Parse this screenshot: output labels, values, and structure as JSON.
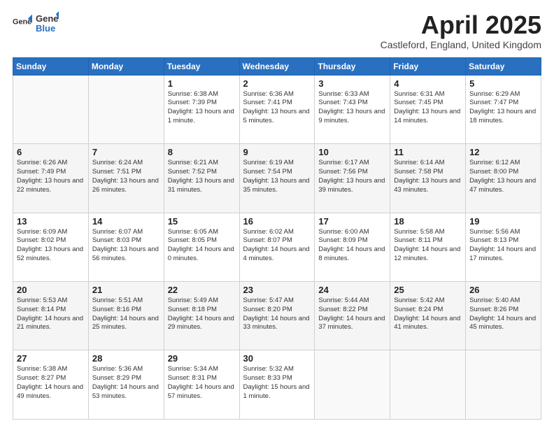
{
  "header": {
    "logo_general": "General",
    "logo_blue": "Blue",
    "month_title": "April 2025",
    "location": "Castleford, England, United Kingdom"
  },
  "days_of_week": [
    "Sunday",
    "Monday",
    "Tuesday",
    "Wednesday",
    "Thursday",
    "Friday",
    "Saturday"
  ],
  "weeks": [
    [
      {
        "day": "",
        "info": ""
      },
      {
        "day": "",
        "info": ""
      },
      {
        "day": "1",
        "info": "Sunrise: 6:38 AM\nSunset: 7:39 PM\nDaylight: 13 hours and 1 minute."
      },
      {
        "day": "2",
        "info": "Sunrise: 6:36 AM\nSunset: 7:41 PM\nDaylight: 13 hours and 5 minutes."
      },
      {
        "day": "3",
        "info": "Sunrise: 6:33 AM\nSunset: 7:43 PM\nDaylight: 13 hours and 9 minutes."
      },
      {
        "day": "4",
        "info": "Sunrise: 6:31 AM\nSunset: 7:45 PM\nDaylight: 13 hours and 14 minutes."
      },
      {
        "day": "5",
        "info": "Sunrise: 6:29 AM\nSunset: 7:47 PM\nDaylight: 13 hours and 18 minutes."
      }
    ],
    [
      {
        "day": "6",
        "info": "Sunrise: 6:26 AM\nSunset: 7:49 PM\nDaylight: 13 hours and 22 minutes."
      },
      {
        "day": "7",
        "info": "Sunrise: 6:24 AM\nSunset: 7:51 PM\nDaylight: 13 hours and 26 minutes."
      },
      {
        "day": "8",
        "info": "Sunrise: 6:21 AM\nSunset: 7:52 PM\nDaylight: 13 hours and 31 minutes."
      },
      {
        "day": "9",
        "info": "Sunrise: 6:19 AM\nSunset: 7:54 PM\nDaylight: 13 hours and 35 minutes."
      },
      {
        "day": "10",
        "info": "Sunrise: 6:17 AM\nSunset: 7:56 PM\nDaylight: 13 hours and 39 minutes."
      },
      {
        "day": "11",
        "info": "Sunrise: 6:14 AM\nSunset: 7:58 PM\nDaylight: 13 hours and 43 minutes."
      },
      {
        "day": "12",
        "info": "Sunrise: 6:12 AM\nSunset: 8:00 PM\nDaylight: 13 hours and 47 minutes."
      }
    ],
    [
      {
        "day": "13",
        "info": "Sunrise: 6:09 AM\nSunset: 8:02 PM\nDaylight: 13 hours and 52 minutes."
      },
      {
        "day": "14",
        "info": "Sunrise: 6:07 AM\nSunset: 8:03 PM\nDaylight: 13 hours and 56 minutes."
      },
      {
        "day": "15",
        "info": "Sunrise: 6:05 AM\nSunset: 8:05 PM\nDaylight: 14 hours and 0 minutes."
      },
      {
        "day": "16",
        "info": "Sunrise: 6:02 AM\nSunset: 8:07 PM\nDaylight: 14 hours and 4 minutes."
      },
      {
        "day": "17",
        "info": "Sunrise: 6:00 AM\nSunset: 8:09 PM\nDaylight: 14 hours and 8 minutes."
      },
      {
        "day": "18",
        "info": "Sunrise: 5:58 AM\nSunset: 8:11 PM\nDaylight: 14 hours and 12 minutes."
      },
      {
        "day": "19",
        "info": "Sunrise: 5:56 AM\nSunset: 8:13 PM\nDaylight: 14 hours and 17 minutes."
      }
    ],
    [
      {
        "day": "20",
        "info": "Sunrise: 5:53 AM\nSunset: 8:14 PM\nDaylight: 14 hours and 21 minutes."
      },
      {
        "day": "21",
        "info": "Sunrise: 5:51 AM\nSunset: 8:16 PM\nDaylight: 14 hours and 25 minutes."
      },
      {
        "day": "22",
        "info": "Sunrise: 5:49 AM\nSunset: 8:18 PM\nDaylight: 14 hours and 29 minutes."
      },
      {
        "day": "23",
        "info": "Sunrise: 5:47 AM\nSunset: 8:20 PM\nDaylight: 14 hours and 33 minutes."
      },
      {
        "day": "24",
        "info": "Sunrise: 5:44 AM\nSunset: 8:22 PM\nDaylight: 14 hours and 37 minutes."
      },
      {
        "day": "25",
        "info": "Sunrise: 5:42 AM\nSunset: 8:24 PM\nDaylight: 14 hours and 41 minutes."
      },
      {
        "day": "26",
        "info": "Sunrise: 5:40 AM\nSunset: 8:26 PM\nDaylight: 14 hours and 45 minutes."
      }
    ],
    [
      {
        "day": "27",
        "info": "Sunrise: 5:38 AM\nSunset: 8:27 PM\nDaylight: 14 hours and 49 minutes."
      },
      {
        "day": "28",
        "info": "Sunrise: 5:36 AM\nSunset: 8:29 PM\nDaylight: 14 hours and 53 minutes."
      },
      {
        "day": "29",
        "info": "Sunrise: 5:34 AM\nSunset: 8:31 PM\nDaylight: 14 hours and 57 minutes."
      },
      {
        "day": "30",
        "info": "Sunrise: 5:32 AM\nSunset: 8:33 PM\nDaylight: 15 hours and 1 minute."
      },
      {
        "day": "",
        "info": ""
      },
      {
        "day": "",
        "info": ""
      },
      {
        "day": "",
        "info": ""
      }
    ]
  ]
}
